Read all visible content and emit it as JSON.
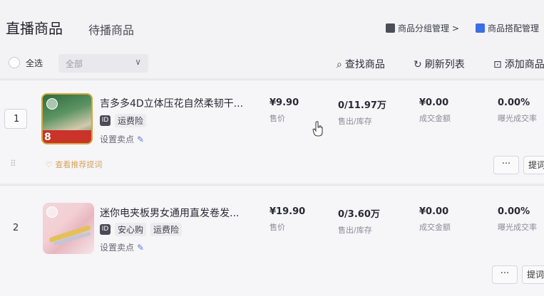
{
  "tabs": {
    "active": "直播商品",
    "inactive": "待播商品"
  },
  "top_actions": {
    "group_manage": "商品分组管理 >",
    "bundle_manage": "商品搭配管理"
  },
  "toolbar": {
    "select_all": "全选",
    "filter_value": "全部",
    "filter_chevron": "∨",
    "search": "查找商品",
    "refresh": "刷新列表",
    "add": "添加商品"
  },
  "products": [
    {
      "index": "1",
      "title": "吉多多4D立体压花自然柔韧干...",
      "tags": [
        "运费险"
      ],
      "sell_point": "设置卖点",
      "price": "¥9.90",
      "price_label": "售价",
      "sold_stock": "0/11.97万",
      "sold_stock_label": "售出/库存",
      "amount": "¥0.00",
      "amount_label": "成交金额",
      "rate": "0.00%",
      "rate_label": "曝光成交率",
      "recommend": "查看推荐提词",
      "more": "···",
      "action": "提词"
    },
    {
      "index": "2",
      "title": "迷你电夹板男女通用直发卷发...",
      "tags": [
        "安心购",
        "运费险"
      ],
      "sell_point": "设置卖点",
      "price": "¥19.90",
      "price_label": "售价",
      "sold_stock": "0/3.60万",
      "sold_stock_label": "售出/库存",
      "amount": "¥0.00",
      "amount_label": "成交金额",
      "rate": "0.00%",
      "rate_label": "曝光成交率",
      "more": "···",
      "action": "提词"
    }
  ],
  "colors": {
    "accent_blue": "#3b6ee8",
    "recommend_gold": "#d4a45a",
    "thumb_red": "#c93329"
  }
}
